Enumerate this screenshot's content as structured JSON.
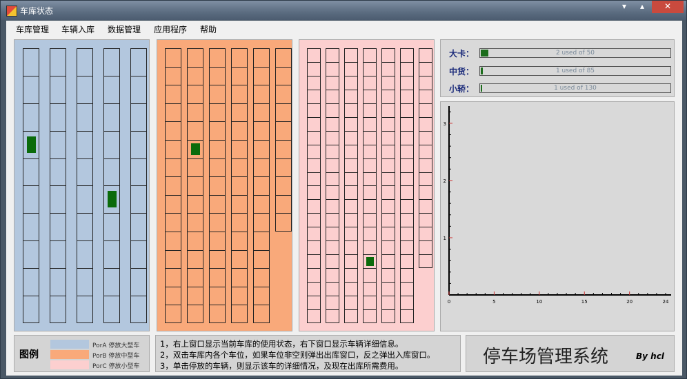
{
  "window": {
    "title": "车库状态",
    "controls": [
      "▾",
      "▴",
      "✕"
    ]
  },
  "menu": [
    "车库管理",
    "车辆入库",
    "数据管理",
    "应用程序",
    "帮助"
  ],
  "garages": [
    {
      "name": "PorA",
      "color": "#b3c7de",
      "columns": 5,
      "rows": 10,
      "occupied": [
        [
          0,
          3
        ],
        [
          3,
          5
        ]
      ]
    },
    {
      "name": "PorB",
      "color": "#f9a97a",
      "columns": 6,
      "rows": 15,
      "short_col_rows": 10,
      "occupied": [
        [
          1,
          5
        ]
      ]
    },
    {
      "name": "PorC",
      "color": "#fccfcf",
      "columns": 7,
      "rows": 20,
      "short_col_rows": 16,
      "occupied": [
        [
          3,
          15
        ]
      ]
    }
  ],
  "status": [
    {
      "label": "大卡：",
      "text": "2 used of 50",
      "fraction": 0.04
    },
    {
      "label": "中货：",
      "text": "1 used of 85",
      "fraction": 0.012
    },
    {
      "label": "小轿：",
      "text": "1 used of 130",
      "fraction": 0.008
    }
  ],
  "chart_data": {
    "type": "line",
    "x": [],
    "series": [],
    "x_ticks": [
      "0",
      "5",
      "10",
      "15",
      "20",
      "24"
    ],
    "y_ticks": [
      "1",
      "2",
      "3"
    ],
    "xlim": [
      0,
      24
    ],
    "ylim": [
      0,
      3.3
    ]
  },
  "legend": {
    "title": "图例",
    "items": [
      {
        "text": "PorA 停放大型车",
        "color": "#b3c7de"
      },
      {
        "text": "PorB 停放中型车",
        "color": "#f9a97a"
      },
      {
        "text": "PorC 停放小型车",
        "color": "#fccfcf"
      }
    ]
  },
  "instructions": [
    "1，右上窗口显示当前车库的使用状态，右下窗口显示车辆详细信息。",
    "2，双击车库内各个车位，如果车位非空则弹出出库窗口，反之弹出入库窗口。",
    "3，单击停放的车辆，则显示该车的详细情况，及现在出库所需费用。"
  ],
  "app_name": "停车场管理系统",
  "author": "By hcl",
  "colors": {
    "occupied": "#0b6b0b"
  }
}
